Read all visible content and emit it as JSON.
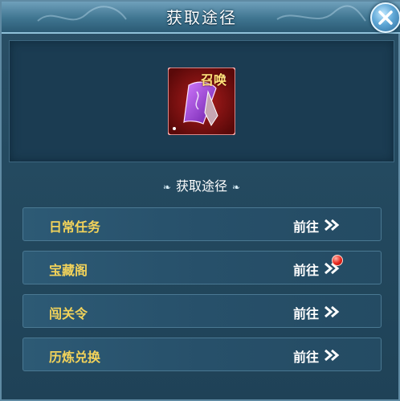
{
  "window": {
    "title": "获取途径"
  },
  "item": {
    "icon": "summon-scroll-icon",
    "label": "召唤"
  },
  "section": {
    "label": "获取途径",
    "deco_left": "❧",
    "deco_right": "❧"
  },
  "routes": [
    {
      "name": "日常任务",
      "action": "前往",
      "notification": false
    },
    {
      "name": "宝藏阁",
      "action": "前往",
      "notification": true
    },
    {
      "name": "闯关令",
      "action": "前往",
      "notification": false
    },
    {
      "name": "历炼兑换",
      "action": "前往",
      "notification": false
    }
  ],
  "colors": {
    "accent": "#f3d35a",
    "dot": "#e8241b"
  }
}
